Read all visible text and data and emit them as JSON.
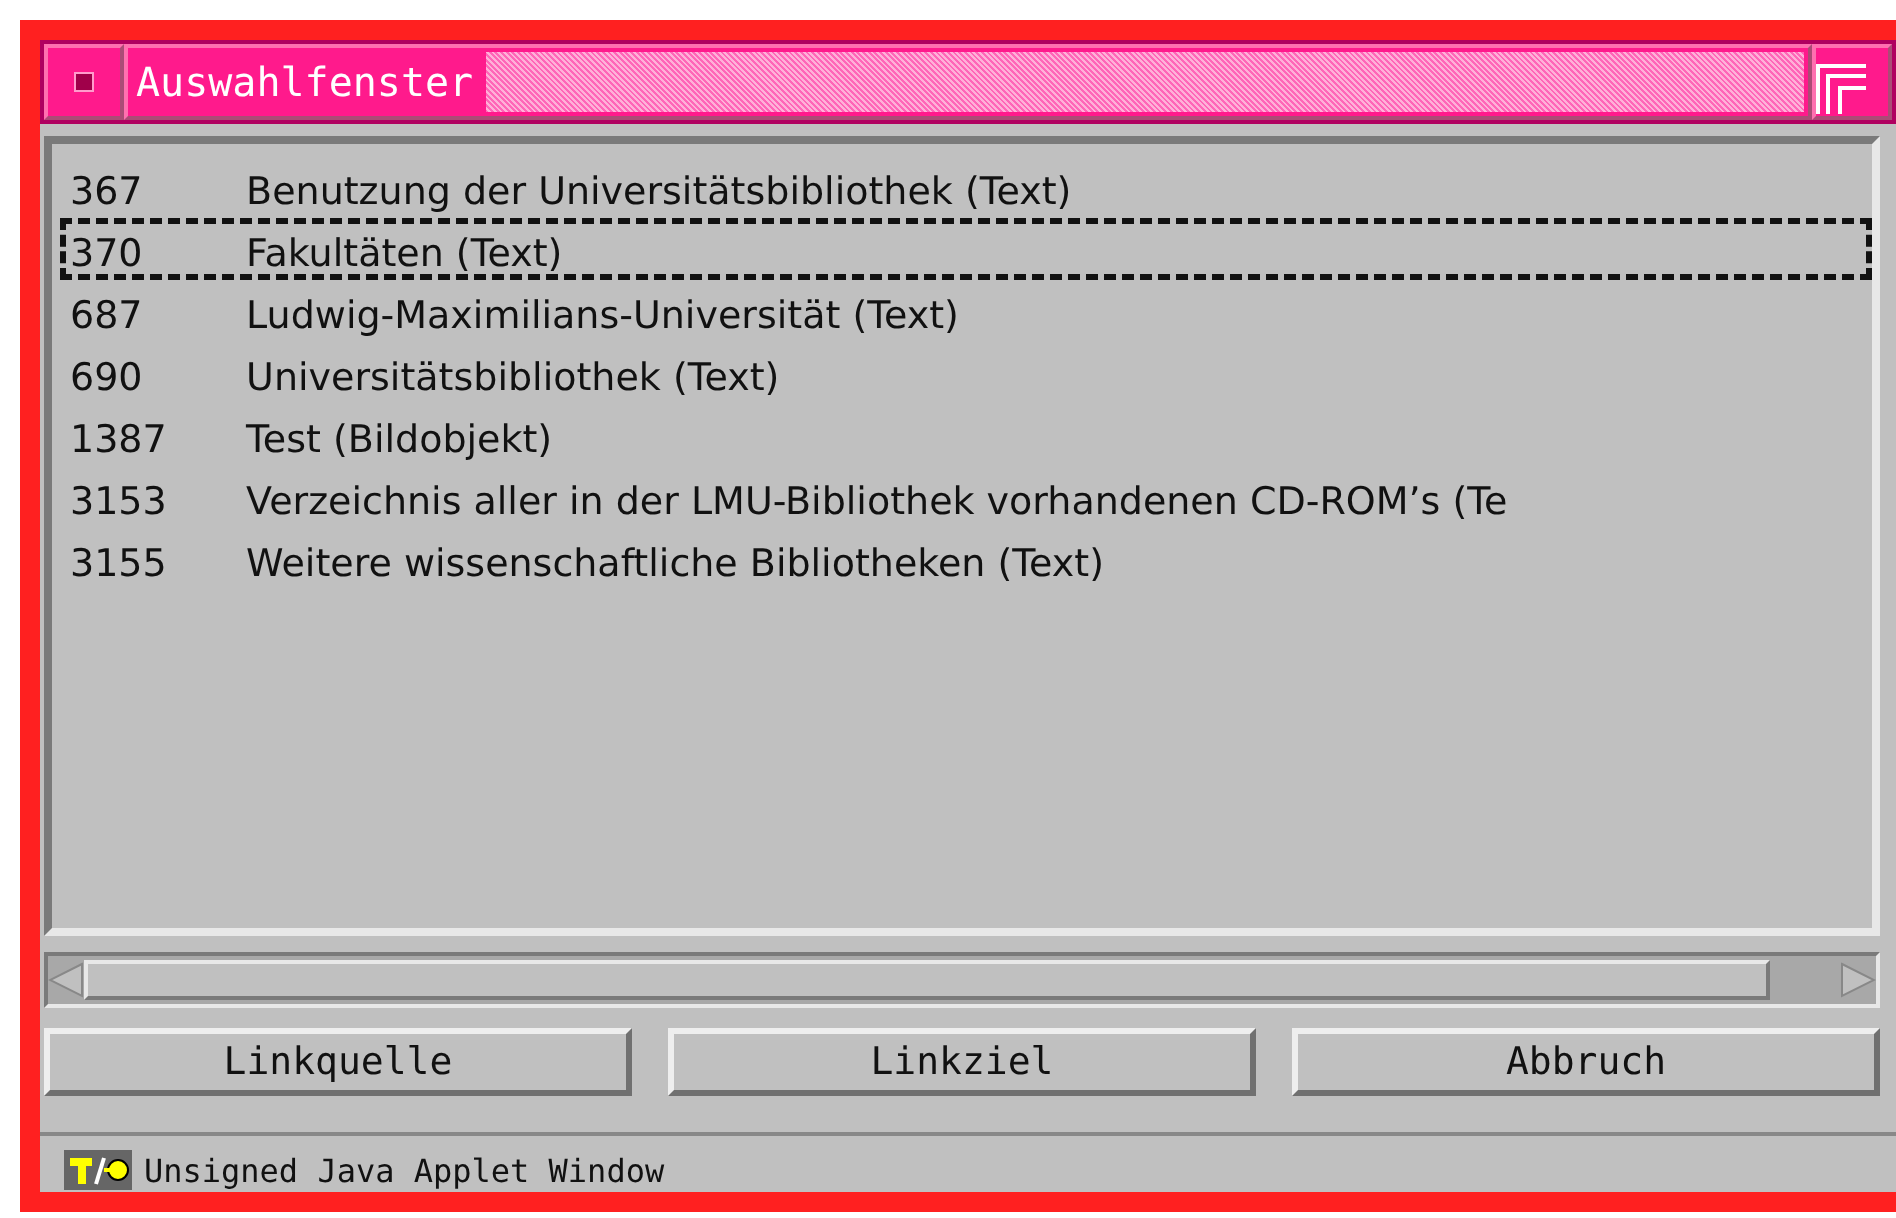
{
  "window": {
    "title": "Auswahlfenster"
  },
  "list": {
    "rows": [
      {
        "number": "367",
        "label": "Benutzung der Universitätsbibliothek (Text)",
        "focused": false
      },
      {
        "number": "370",
        "label": "Fakultäten (Text)",
        "focused": true
      },
      {
        "number": "687",
        "label": "Ludwig-Maximilians-Universität (Text)",
        "focused": false
      },
      {
        "number": "690",
        "label": "Universitätsbibliothek (Text)",
        "focused": false
      },
      {
        "number": "1387",
        "label": "Test (Bildobjekt)",
        "focused": false
      },
      {
        "number": "3153",
        "label": "Verzeichnis aller in der LMU-Bibliothek vorhandenen CD-ROM’s (Te",
        "focused": false
      },
      {
        "number": "3155",
        "label": "Weitere wissenschaftliche Bibliotheken (Text)",
        "focused": false
      }
    ]
  },
  "buttons": [
    "Linkquelle",
    "Linkziel",
    "Abbruch"
  ],
  "status_bar": {
    "text": "Unsigned Java Applet Window"
  }
}
